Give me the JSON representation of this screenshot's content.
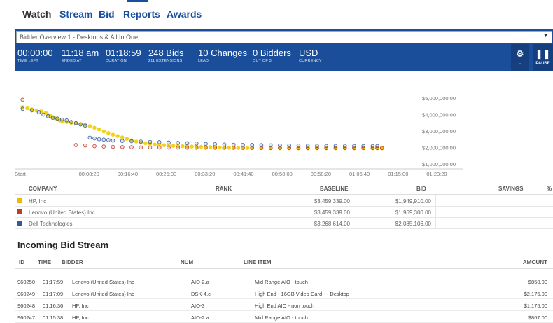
{
  "nav": {
    "tabs": [
      {
        "label": "Watch",
        "active": true
      },
      {
        "label": "Stream",
        "active": false
      },
      {
        "label": "Bid",
        "active": false
      },
      {
        "label": "Reports",
        "active": false
      },
      {
        "label": "Awards",
        "active": false
      }
    ]
  },
  "overview_select": {
    "value": "Bidder Overview 1 - Desktops & All In One"
  },
  "stats": [
    {
      "value": "00:00:00",
      "label": "TIME LEFT"
    },
    {
      "value": "11:18 am",
      "label": "ENDED AT"
    },
    {
      "value": "01:18:59",
      "label": "DURATION"
    },
    {
      "value": "248 Bids",
      "label": "211 EXTENSIONS"
    },
    {
      "value": "10 Changes",
      "label": "LEAD"
    },
    {
      "value": "0 Bidders",
      "label": "OUT OF 3"
    },
    {
      "value": "USD",
      "label": "CURRENCY"
    }
  ],
  "controls": {
    "settings_icon": "gear-icon",
    "pause_icon": "pause-icon",
    "pause_label": "PAUSE"
  },
  "chart_data": {
    "type": "scatter",
    "x_ticks": [
      "Start",
      "00:08:20",
      "00:16:40",
      "00:25:00",
      "00:33:20",
      "00:41:40",
      "00:50:00",
      "00:58:20",
      "01:06:40",
      "01:15:00",
      "01:23:20"
    ],
    "y_ticks": [
      "$5,000,000.00",
      "$4,000,000.00",
      "$3,000,000.00",
      "$2,000,000.00",
      "$1,000,000.00"
    ],
    "ylim": [
      1000000,
      5000000
    ],
    "xlim_minutes": [
      0,
      83.33
    ],
    "grid": false,
    "series": [
      {
        "name": "HP, Inc",
        "color": "#f2d21b",
        "points": [
          [
            0.5,
            4450000
          ],
          [
            1.5,
            4380000
          ],
          [
            2.5,
            4320000
          ],
          [
            3.5,
            4250000
          ],
          [
            4.5,
            4200000
          ],
          [
            5.5,
            4100000
          ],
          [
            6,
            3980000
          ],
          [
            6.5,
            3920000
          ],
          [
            7,
            3850000
          ],
          [
            7.5,
            3780000
          ],
          [
            8,
            3720000
          ],
          [
            8.5,
            3650000
          ],
          [
            9,
            3600000
          ],
          [
            10,
            3550000
          ],
          [
            11,
            3500000
          ],
          [
            12,
            3470000
          ],
          [
            13,
            3430000
          ],
          [
            14,
            3380000
          ],
          [
            15,
            3300000
          ],
          [
            16,
            3200000
          ],
          [
            17,
            3100000
          ],
          [
            18,
            2980000
          ],
          [
            19,
            2880000
          ],
          [
            20,
            2780000
          ],
          [
            21,
            2700000
          ],
          [
            22,
            2620000
          ],
          [
            23,
            2520000
          ],
          [
            24,
            2440000
          ],
          [
            25,
            2360000
          ],
          [
            26,
            2300000
          ],
          [
            27,
            2260000
          ],
          [
            28,
            2220000
          ],
          [
            29,
            2180000
          ],
          [
            30,
            2160000
          ],
          [
            31,
            2140000
          ],
          [
            32,
            2120000
          ],
          [
            33,
            2100000
          ],
          [
            34,
            2090000
          ],
          [
            35,
            2080000
          ],
          [
            36,
            2070000
          ],
          [
            37,
            2060000
          ],
          [
            38,
            2050000
          ],
          [
            39,
            2040000
          ],
          [
            40,
            2030000
          ],
          [
            41,
            2020000
          ],
          [
            42,
            2010000
          ],
          [
            43,
            2000000
          ],
          [
            44,
            1995000
          ],
          [
            45,
            1990000
          ],
          [
            46,
            1985000
          ],
          [
            47,
            1980000
          ],
          [
            48,
            1975000
          ],
          [
            49,
            1970000
          ],
          [
            50,
            1965000
          ],
          [
            52,
            1960000
          ],
          [
            54,
            1958000
          ],
          [
            56,
            1956000
          ],
          [
            58,
            1954000
          ],
          [
            60,
            1952000
          ],
          [
            62,
            1951000
          ],
          [
            64,
            1950500
          ],
          [
            66,
            1950200
          ],
          [
            68,
            1950000
          ],
          [
            70,
            1949950
          ],
          [
            72,
            1949930
          ],
          [
            74,
            1949920
          ],
          [
            76,
            1949915
          ],
          [
            77,
            1949910
          ],
          [
            78,
            1949910
          ]
        ]
      },
      {
        "name": "Lenovo (United States) Inc",
        "color": "#c0392b",
        "points": [
          [
            0.5,
            4900000
          ],
          [
            12,
            2150000
          ],
          [
            14,
            2120000
          ],
          [
            16,
            2080000
          ],
          [
            18,
            2060000
          ],
          [
            20,
            2040000
          ],
          [
            22,
            2030000
          ],
          [
            24,
            2020000
          ],
          [
            26,
            2010000
          ],
          [
            28,
            2005000
          ],
          [
            30,
            2000000
          ],
          [
            32,
            1998000
          ],
          [
            34,
            1995000
          ],
          [
            36,
            1993000
          ],
          [
            38,
            1991000
          ],
          [
            40,
            1990000
          ],
          [
            42,
            1988000
          ],
          [
            44,
            1986000
          ],
          [
            46,
            1985000
          ],
          [
            48,
            1984000
          ],
          [
            50,
            1982000
          ],
          [
            52,
            1980000
          ],
          [
            54,
            1978000
          ],
          [
            56,
            1976000
          ],
          [
            58,
            1975000
          ],
          [
            60,
            1974000
          ],
          [
            62,
            1973000
          ],
          [
            64,
            1972000
          ],
          [
            66,
            1971000
          ],
          [
            68,
            1970500
          ],
          [
            70,
            1970000
          ],
          [
            72,
            1969800
          ],
          [
            74,
            1969500
          ],
          [
            76,
            1969400
          ],
          [
            77,
            1969300
          ],
          [
            78,
            1969300
          ]
        ]
      },
      {
        "name": "Dell Technologies",
        "color": "#2e5aa0",
        "points": [
          [
            0.5,
            4350000
          ],
          [
            2.5,
            4260000
          ],
          [
            4,
            4150000
          ],
          [
            5,
            4000000
          ],
          [
            6,
            3900000
          ],
          [
            7,
            3800000
          ],
          [
            8,
            3760000
          ],
          [
            9,
            3700000
          ],
          [
            10,
            3650000
          ],
          [
            11,
            3550000
          ],
          [
            12,
            3480000
          ],
          [
            13,
            3400000
          ],
          [
            14,
            3330000
          ],
          [
            15,
            2600000
          ],
          [
            16,
            2550000
          ],
          [
            17,
            2500000
          ],
          [
            18,
            2480000
          ],
          [
            19,
            2450000
          ],
          [
            20,
            2420000
          ],
          [
            22,
            2400000
          ],
          [
            24,
            2380000
          ],
          [
            26,
            2360000
          ],
          [
            28,
            2340000
          ],
          [
            30,
            2320000
          ],
          [
            32,
            2300000
          ],
          [
            34,
            2280000
          ],
          [
            36,
            2260000
          ],
          [
            38,
            2240000
          ],
          [
            40,
            2220000
          ],
          [
            42,
            2200000
          ],
          [
            44,
            2180000
          ],
          [
            46,
            2170000
          ],
          [
            48,
            2160000
          ],
          [
            50,
            2150000
          ],
          [
            52,
            2140000
          ],
          [
            54,
            2130000
          ],
          [
            56,
            2120000
          ],
          [
            58,
            2110000
          ],
          [
            60,
            2105000
          ],
          [
            62,
            2100000
          ],
          [
            64,
            2095000
          ],
          [
            66,
            2092000
          ],
          [
            68,
            2090000
          ],
          [
            70,
            2088000
          ],
          [
            72,
            2087000
          ],
          [
            74,
            2086000
          ],
          [
            76,
            2085500
          ],
          [
            77,
            2085106
          ]
        ]
      }
    ]
  },
  "company_table": {
    "headers": {
      "company": "COMPANY",
      "rank": "RANK",
      "baseline": "BASELINE",
      "bid": "BID",
      "savings": "SAVINGS",
      "pct": "%"
    },
    "rows": [
      {
        "company": "HP, Inc",
        "color": "#f2b705",
        "baseline": "$3,459,339.00",
        "bid": "$1,949,910.00"
      },
      {
        "company": "Lenovo (United States) Inc",
        "color": "#c0392b",
        "baseline": "$3,459,339.00",
        "bid": "$1,969,300.00"
      },
      {
        "company": "Dell Technologies",
        "color": "#2e5aa0",
        "baseline": "$3,268,614.00",
        "bid": "$2,085,106.00"
      }
    ]
  },
  "bid_stream": {
    "title": "Incoming Bid Stream",
    "headers": {
      "id": "ID",
      "time": "TIME",
      "bidder": "BIDDER",
      "num": "NUM",
      "line_item": "LINE ITEM",
      "amount": "AMOUNT"
    },
    "rows": [
      {
        "id": "960250",
        "time": "01:17:59",
        "bidder": "Lenovo (United States) Inc",
        "num": "AIO-2.a",
        "line_item": "Mid Range AIO - touch",
        "amount": "$850.00"
      },
      {
        "id": "960249",
        "time": "01:17:09",
        "bidder": "Lenovo (United States) Inc",
        "num": "DSK-4.c",
        "line_item": "High End - 16GB Video Card - - Desktop",
        "amount": "$2,175.00"
      },
      {
        "id": "960248",
        "time": "01:16:36",
        "bidder": "HP, Inc",
        "num": "AIO-3",
        "line_item": "High End AIO - non touch",
        "amount": "$1,175.00"
      },
      {
        "id": "960247",
        "time": "01:15:38",
        "bidder": "HP, Inc",
        "num": "AIO-2.a",
        "line_item": "Mid Range AIO - touch",
        "amount": "$867.00"
      }
    ]
  }
}
